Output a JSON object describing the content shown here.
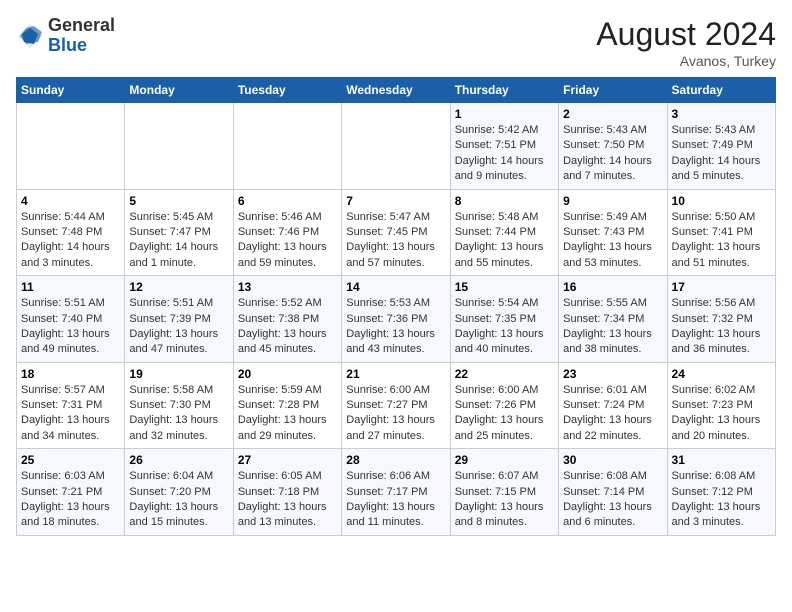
{
  "logo": {
    "general": "General",
    "blue": "Blue"
  },
  "title": "August 2024",
  "subtitle": "Avanos, Turkey",
  "days_of_week": [
    "Sunday",
    "Monday",
    "Tuesday",
    "Wednesday",
    "Thursday",
    "Friday",
    "Saturday"
  ],
  "weeks": [
    [
      {
        "day": "",
        "info": ""
      },
      {
        "day": "",
        "info": ""
      },
      {
        "day": "",
        "info": ""
      },
      {
        "day": "",
        "info": ""
      },
      {
        "day": "1",
        "info": "Sunrise: 5:42 AM\nSunset: 7:51 PM\nDaylight: 14 hours\nand 9 minutes."
      },
      {
        "day": "2",
        "info": "Sunrise: 5:43 AM\nSunset: 7:50 PM\nDaylight: 14 hours\nand 7 minutes."
      },
      {
        "day": "3",
        "info": "Sunrise: 5:43 AM\nSunset: 7:49 PM\nDaylight: 14 hours\nand 5 minutes."
      }
    ],
    [
      {
        "day": "4",
        "info": "Sunrise: 5:44 AM\nSunset: 7:48 PM\nDaylight: 14 hours\nand 3 minutes."
      },
      {
        "day": "5",
        "info": "Sunrise: 5:45 AM\nSunset: 7:47 PM\nDaylight: 14 hours\nand 1 minute."
      },
      {
        "day": "6",
        "info": "Sunrise: 5:46 AM\nSunset: 7:46 PM\nDaylight: 13 hours\nand 59 minutes."
      },
      {
        "day": "7",
        "info": "Sunrise: 5:47 AM\nSunset: 7:45 PM\nDaylight: 13 hours\nand 57 minutes."
      },
      {
        "day": "8",
        "info": "Sunrise: 5:48 AM\nSunset: 7:44 PM\nDaylight: 13 hours\nand 55 minutes."
      },
      {
        "day": "9",
        "info": "Sunrise: 5:49 AM\nSunset: 7:43 PM\nDaylight: 13 hours\nand 53 minutes."
      },
      {
        "day": "10",
        "info": "Sunrise: 5:50 AM\nSunset: 7:41 PM\nDaylight: 13 hours\nand 51 minutes."
      }
    ],
    [
      {
        "day": "11",
        "info": "Sunrise: 5:51 AM\nSunset: 7:40 PM\nDaylight: 13 hours\nand 49 minutes."
      },
      {
        "day": "12",
        "info": "Sunrise: 5:51 AM\nSunset: 7:39 PM\nDaylight: 13 hours\nand 47 minutes."
      },
      {
        "day": "13",
        "info": "Sunrise: 5:52 AM\nSunset: 7:38 PM\nDaylight: 13 hours\nand 45 minutes."
      },
      {
        "day": "14",
        "info": "Sunrise: 5:53 AM\nSunset: 7:36 PM\nDaylight: 13 hours\nand 43 minutes."
      },
      {
        "day": "15",
        "info": "Sunrise: 5:54 AM\nSunset: 7:35 PM\nDaylight: 13 hours\nand 40 minutes."
      },
      {
        "day": "16",
        "info": "Sunrise: 5:55 AM\nSunset: 7:34 PM\nDaylight: 13 hours\nand 38 minutes."
      },
      {
        "day": "17",
        "info": "Sunrise: 5:56 AM\nSunset: 7:32 PM\nDaylight: 13 hours\nand 36 minutes."
      }
    ],
    [
      {
        "day": "18",
        "info": "Sunrise: 5:57 AM\nSunset: 7:31 PM\nDaylight: 13 hours\nand 34 minutes."
      },
      {
        "day": "19",
        "info": "Sunrise: 5:58 AM\nSunset: 7:30 PM\nDaylight: 13 hours\nand 32 minutes."
      },
      {
        "day": "20",
        "info": "Sunrise: 5:59 AM\nSunset: 7:28 PM\nDaylight: 13 hours\nand 29 minutes."
      },
      {
        "day": "21",
        "info": "Sunrise: 6:00 AM\nSunset: 7:27 PM\nDaylight: 13 hours\nand 27 minutes."
      },
      {
        "day": "22",
        "info": "Sunrise: 6:00 AM\nSunset: 7:26 PM\nDaylight: 13 hours\nand 25 minutes."
      },
      {
        "day": "23",
        "info": "Sunrise: 6:01 AM\nSunset: 7:24 PM\nDaylight: 13 hours\nand 22 minutes."
      },
      {
        "day": "24",
        "info": "Sunrise: 6:02 AM\nSunset: 7:23 PM\nDaylight: 13 hours\nand 20 minutes."
      }
    ],
    [
      {
        "day": "25",
        "info": "Sunrise: 6:03 AM\nSunset: 7:21 PM\nDaylight: 13 hours\nand 18 minutes."
      },
      {
        "day": "26",
        "info": "Sunrise: 6:04 AM\nSunset: 7:20 PM\nDaylight: 13 hours\nand 15 minutes."
      },
      {
        "day": "27",
        "info": "Sunrise: 6:05 AM\nSunset: 7:18 PM\nDaylight: 13 hours\nand 13 minutes."
      },
      {
        "day": "28",
        "info": "Sunrise: 6:06 AM\nSunset: 7:17 PM\nDaylight: 13 hours\nand 11 minutes."
      },
      {
        "day": "29",
        "info": "Sunrise: 6:07 AM\nSunset: 7:15 PM\nDaylight: 13 hours\nand 8 minutes."
      },
      {
        "day": "30",
        "info": "Sunrise: 6:08 AM\nSunset: 7:14 PM\nDaylight: 13 hours\nand 6 minutes."
      },
      {
        "day": "31",
        "info": "Sunrise: 6:08 AM\nSunset: 7:12 PM\nDaylight: 13 hours\nand 3 minutes."
      }
    ]
  ]
}
